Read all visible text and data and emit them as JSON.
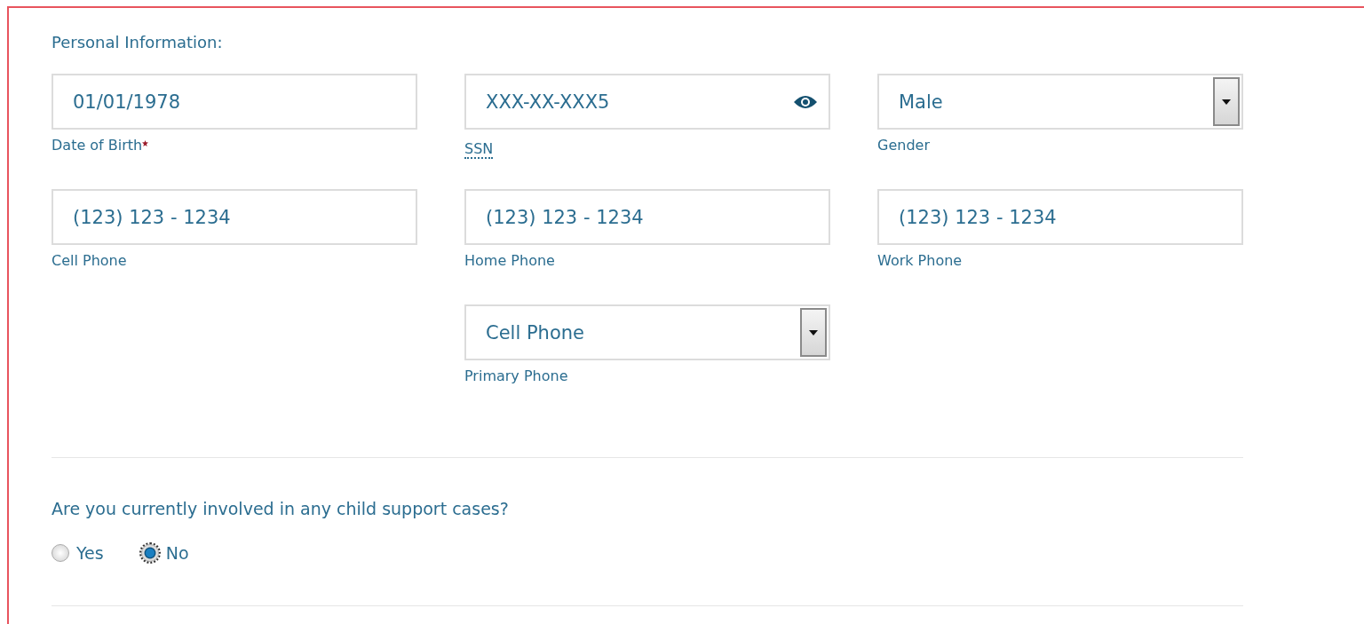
{
  "section_title": "Personal Information:",
  "field_rows": [
    [
      {
        "kind": "text",
        "value": "01/01/1978",
        "label": "Date of Birth",
        "required": true
      },
      {
        "kind": "secret",
        "value": "XXX-XX-XXX5",
        "label": "SSN",
        "required": false,
        "has_tooltip": true
      },
      {
        "kind": "select",
        "value": "Male",
        "label": "Gender",
        "required": false
      }
    ],
    [
      {
        "kind": "text",
        "value": "(123) 123 - 1234",
        "label": "Cell Phone",
        "required": false
      },
      {
        "kind": "text",
        "value": "(123) 123 - 1234",
        "label": "Home Phone",
        "required": false
      },
      {
        "kind": "text",
        "value": "(123) 123 - 1234",
        "label": "Work Phone",
        "required": false
      }
    ],
    [
      {
        "kind": "select",
        "value": "Cell Phone",
        "label": "Primary Phone",
        "required": false
      }
    ]
  ],
  "question": "Are you currently involved in any child support cases?",
  "options": [
    {
      "label": "Yes",
      "selected": false
    },
    {
      "label": "No",
      "selected": true
    }
  ]
}
